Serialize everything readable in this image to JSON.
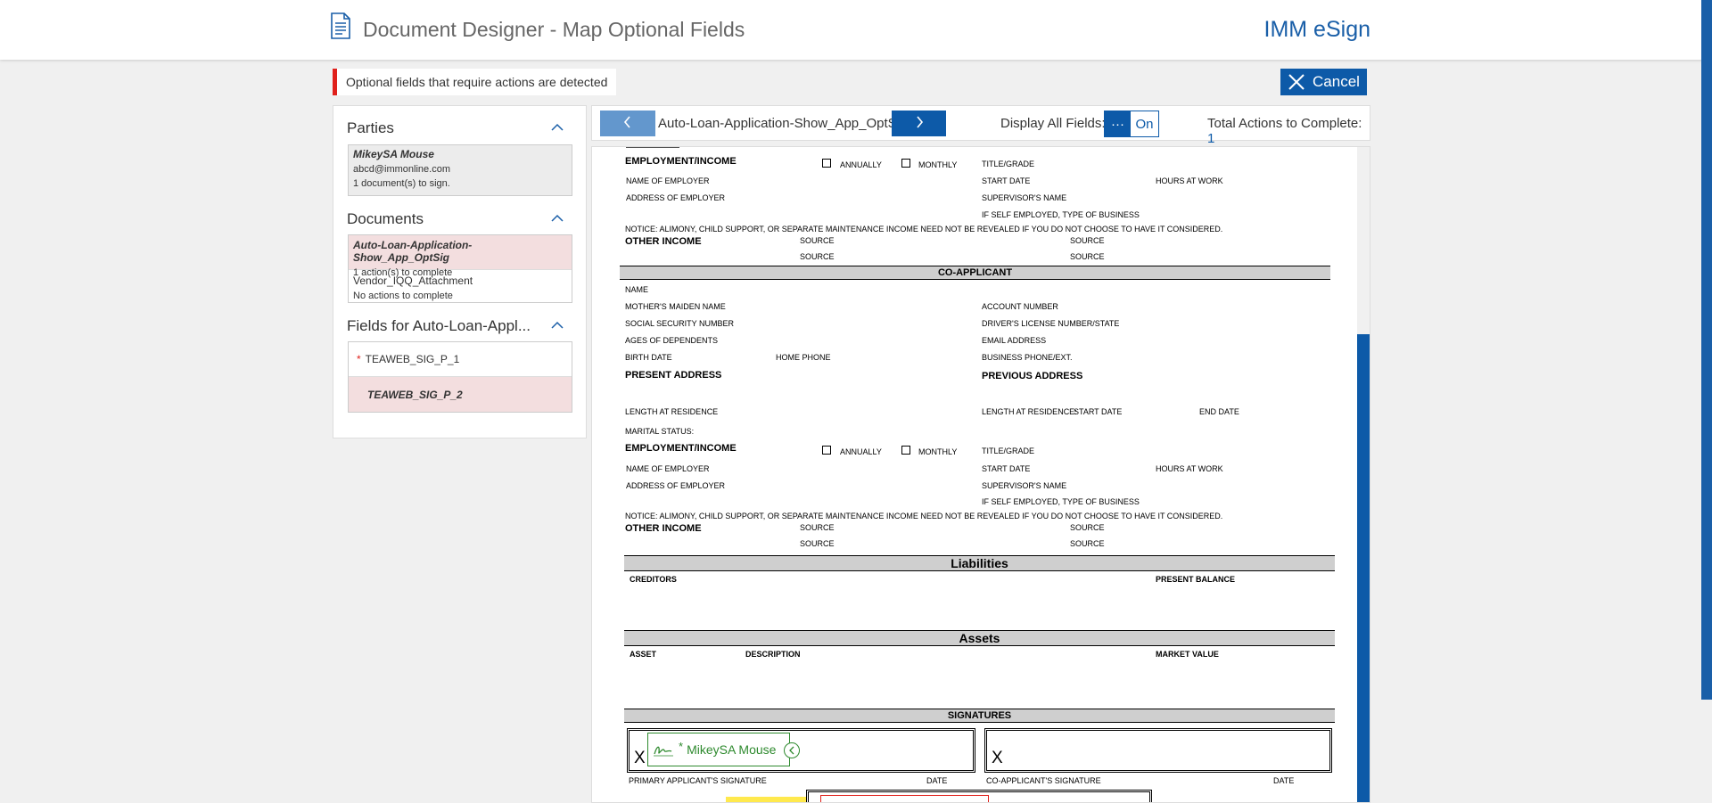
{
  "header": {
    "title": "Document Designer - Map Optional Fields",
    "brand": "IMM eSign"
  },
  "alert": {
    "message": "Optional fields that require actions are detected"
  },
  "actions": {
    "cancel_label": "Cancel"
  },
  "sidebar": {
    "parties": {
      "heading": "Parties",
      "party_name": "MikeySA Mouse",
      "party_email": "abcd@immonline.com",
      "party_status": "1 document(s) to sign."
    },
    "documents": {
      "heading": "Documents",
      "items": [
        {
          "name": "Auto-Loan-Application-Show_App_OptSig",
          "status": "1 action(s) to complete"
        },
        {
          "name": "Vendor_IQQ_Attachment",
          "status": "No actions to complete"
        }
      ]
    },
    "fields": {
      "heading": "Fields for Auto-Loan-Appl...",
      "items": [
        {
          "required_mark": "*",
          "name": "TEAWEB_SIG_P_1"
        },
        {
          "name": "TEAWEB_SIG_P_2"
        }
      ]
    }
  },
  "toolbar": {
    "prev_icon": "chevron-left-icon",
    "current_document": "Auto-Loan-Application-Show_App_OptSig",
    "next_icon": "chevron-right-icon",
    "display_all_label": "Display All Fields:",
    "toggle_dots": "···",
    "toggle_state": "On",
    "total_label": "Total Actions to Complete:",
    "total_value": "1"
  },
  "document": {
    "emp1": {
      "heading": "EMPLOYMENT/INCOME",
      "annually": "ANNUALLY",
      "monthly": "MONTHLY",
      "title_grade": "TITLE/GRADE",
      "name_of_employer": "NAME OF EMPLOYER",
      "start_date": "START DATE",
      "hours_at_work": "HOURS AT WORK",
      "address_of_employer": "ADDRESS OF EMPLOYER",
      "supervisors_name": "SUPERVISOR'S NAME",
      "self_employed": "IF SELF EMPLOYED, TYPE OF BUSINESS",
      "notice": "NOTICE: ALIMONY, CHILD SUPPORT, OR SEPARATE MAINTENANCE INCOME NEED NOT BE REVEALED IF YOU DO NOT CHOOSE TO HAVE IT CONSIDERED.",
      "other_income": "OTHER INCOME",
      "source": "SOURCE"
    },
    "coapplicant": {
      "heading": "CO-APPLICANT",
      "name": "NAME",
      "maiden_name": "MOTHER'S MAIDEN NAME",
      "account_number": "ACCOUNT NUMBER",
      "ssn": "SOCIAL SECURITY NUMBER",
      "license": "DRIVER'S LICENSE NUMBER/STATE",
      "dependents": "AGES OF DEPENDENTS",
      "email": "EMAIL ADDRESS",
      "birth_date": "BIRTH DATE",
      "home_phone": "HOME PHONE",
      "business_phone": "BUSINESS PHONE/EXT.",
      "present_address": "PRESENT ADDRESS",
      "previous_address": "PREVIOUS ADDRESS",
      "length_residence": "LENGTH AT RESIDENCE",
      "length_residence_prev": "LENGTH AT RESIDENCE:",
      "start_date": "START DATE",
      "end_date": "END DATE",
      "marital_status": "MARITAL STATUS:"
    },
    "liabilities": {
      "heading": "Liabilities",
      "creditors": "CREDITORS",
      "present_balance": "PRESENT BALANCE"
    },
    "assets": {
      "heading": "Assets",
      "asset": "ASSET",
      "description": "DESCRIPTION",
      "market_value": "MARKET VALUE"
    },
    "signatures": {
      "heading": "SIGNATURES",
      "x_mark": "X",
      "signer_name": "MikeySA Mouse",
      "required_mark": "*",
      "primary_label": "PRIMARY APPLICANT'S SIGNATURE",
      "co_label": "CO-APPLICANT'S SIGNATURE",
      "date": "DATE"
    }
  },
  "colors": {
    "brand_blue": "#0d5aa8",
    "alert_red": "#e0201b",
    "highlight_pink": "#f3dedf",
    "signature_green": "#2e8a2e"
  }
}
